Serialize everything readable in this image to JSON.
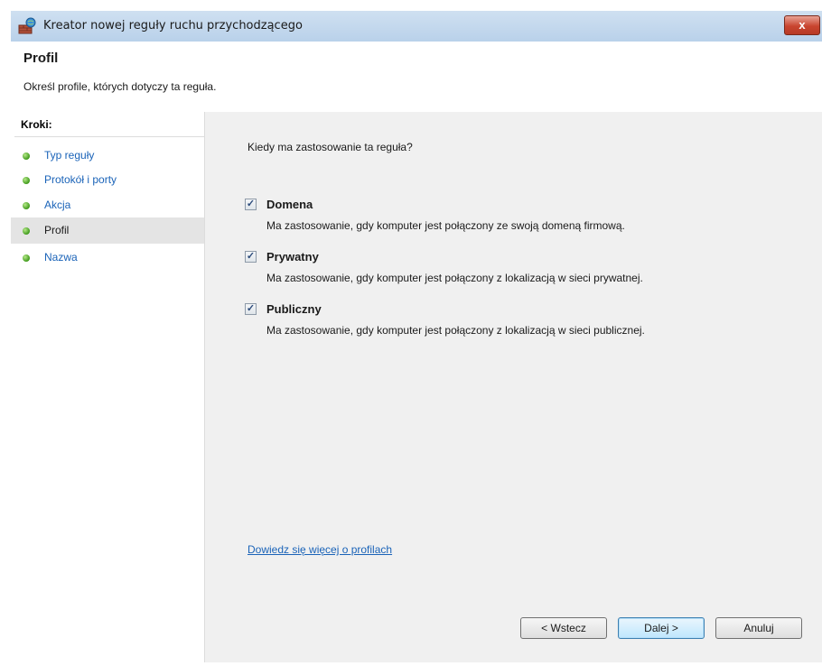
{
  "window": {
    "title": "Kreator nowej reguły ruchu przychodzącego",
    "close_label": "x",
    "icon": "firewall-wizard-icon"
  },
  "header": {
    "title": "Profil",
    "subtitle": "Określ profile, których dotyczy ta reguła."
  },
  "steps": {
    "label": "Kroki:",
    "items": [
      {
        "label": "Typ reguły",
        "active": false
      },
      {
        "label": "Protokół i porty",
        "active": false
      },
      {
        "label": "Akcja",
        "active": false
      },
      {
        "label": "Profil",
        "active": true
      },
      {
        "label": "Nazwa",
        "active": false
      }
    ]
  },
  "content": {
    "question": "Kiedy ma zastosowanie ta reguła?",
    "profiles": [
      {
        "name": "Domena",
        "checked": true,
        "description": "Ma zastosowanie, gdy komputer jest połączony ze swoją domeną firmową."
      },
      {
        "name": "Prywatny",
        "checked": true,
        "description": "Ma zastosowanie, gdy komputer jest połączony z lokalizacją w sieci prywatnej."
      },
      {
        "name": "Publiczny",
        "checked": true,
        "description": "Ma zastosowanie, gdy komputer jest połączony z lokalizacją w sieci publicznej."
      }
    ],
    "learn_more_link": "Dowiedz się więcej o profilach"
  },
  "buttons": {
    "back": "< Wstecz",
    "next": "Dalej >",
    "cancel": "Anuluj"
  },
  "colors": {
    "link": "#1a63b8",
    "step_dot": "#3f9a1b",
    "titlebar": "#b9d1ea",
    "close_button": "#c9452f"
  }
}
